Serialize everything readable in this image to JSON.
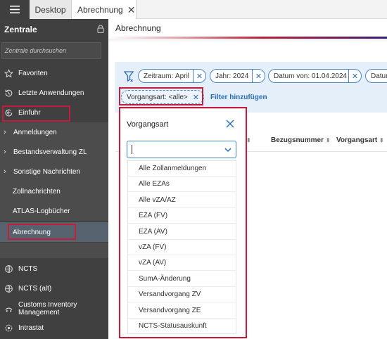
{
  "tabs": {
    "desktop": "Desktop",
    "abrechnung": "Abrechnung"
  },
  "sidebar": {
    "title": "Zentrale",
    "search_placeholder": "Zentrale durchsuchen",
    "items": [
      {
        "label": "Favoriten",
        "icon": "star-icon"
      },
      {
        "label": "Letzte Anwendungen",
        "icon": "history-icon"
      },
      {
        "label": "Einfuhr",
        "icon": "import-icon"
      },
      {
        "label": "Anmeldungen"
      },
      {
        "label": "Bestandsverwaltung ZL"
      },
      {
        "label": "Sonstige Nachrichten"
      },
      {
        "label": "Zollnachrichten"
      },
      {
        "label": "ATLAS-Logbücher"
      },
      {
        "label": "Abrechnung"
      },
      {
        "label": "NCTS",
        "icon": "globe-icon"
      },
      {
        "label": "NCTS (alt)",
        "icon": "globe-icon"
      },
      {
        "label": "Customs Inventory Management",
        "icon": "cim-icon"
      },
      {
        "label": "Intrastat",
        "icon": "intrastat-icon"
      }
    ]
  },
  "main": {
    "title": "Abrechnung"
  },
  "filters": {
    "chips": [
      {
        "label": "Zeitraum:",
        "value": "April"
      },
      {
        "label": "Jahr:",
        "value": "2024"
      },
      {
        "label": "Datum von:",
        "value": "01.04.2024"
      },
      {
        "label": "Datum",
        "value": ""
      }
    ],
    "active_chip": {
      "label": "Vorgangsart:",
      "value": "<alle>"
    },
    "add_label": "Filter hinzufügen"
  },
  "table": {
    "columns": [
      "Bezugsnummer",
      "Vorgangsart"
    ]
  },
  "dropdown": {
    "title": "Vorgangsart",
    "input_value": "",
    "options": [
      "Alle Zollanmeldungen",
      "Alle EZAs",
      "Alle vZA/AZ",
      "EZA (FV)",
      "EZA (AV)",
      "vZA (FV)",
      "vZA (AV)",
      "SumA-Änderung",
      "Versandvorgang ZV",
      "Versandvorgang ZE",
      "NCTS-Statusauskunft"
    ]
  },
  "colors": {
    "highlight": "#c21d3b",
    "accent_blue": "#2a6bb5",
    "sidebar_bg": "#404040"
  }
}
